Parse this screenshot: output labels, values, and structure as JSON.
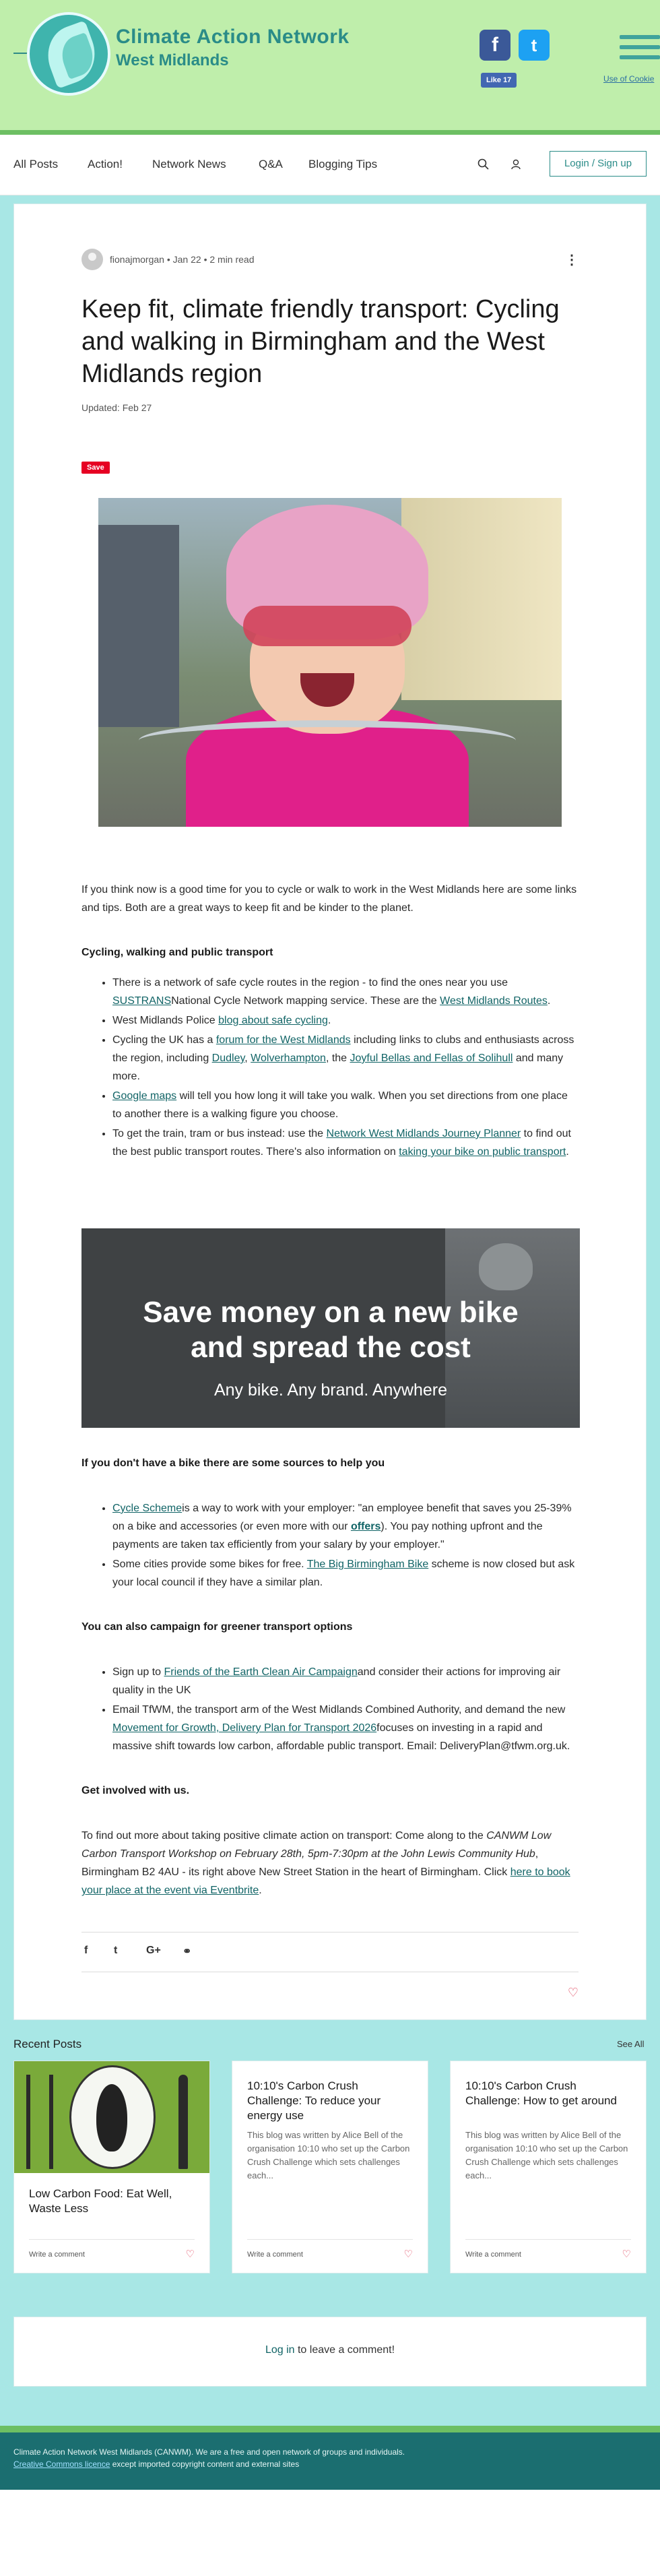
{
  "header": {
    "title": "Climate Action Network",
    "subtitle": "West Midlands",
    "facebook_glyph": "f",
    "twitter_glyph": "t",
    "like_label": "Like 17",
    "cookie_link": "Use of Cookie",
    "logo_icon": "leaf-logo-icon",
    "colors": {
      "header_bg": "#bfeeab",
      "brand": "#2a8c88",
      "page_bg": "#a8e7e5"
    }
  },
  "nav": {
    "items": [
      "All Posts",
      "Action!",
      "Network News",
      "Q&A",
      "Blogging Tips"
    ],
    "login_label": "Login / Sign up",
    "search_icon": "search-icon",
    "user_icon": "user-icon"
  },
  "post": {
    "author": "fionajmorgan",
    "date": "Jan 22",
    "read_time": "2 min read",
    "meta_sep": "•",
    "more": "⋮",
    "title": "Keep fit, climate friendly transport: Cycling and walking in Birmingham and the West Midlands region",
    "updated": "Updated: Feb 27",
    "save_label": "Save",
    "intro": "If you think now is a good time for you to cycle or walk to work in the West Midlands here are some links and tips.  Both are a great ways to keep fit and be kinder to the planet.",
    "section1": {
      "heading": "Cycling, walking and public transport",
      "b1_a": "There is a network of safe cycle routes in the region - to find the ones near you use ",
      "b1_link1": "SUSTRANS",
      "b1_b": "National Cycle Network mapping service.  These are the ",
      "b1_link2": "West Midlands Routes",
      "b1_c": ".",
      "b2_a": "West Midlands Police ",
      "b2_link": "blog about safe cycling",
      "b2_b": ".",
      "b3_a": "Cycling the UK has a ",
      "b3_link1": "forum for the West Midlands",
      "b3_b": " including links to clubs and enthusiasts across the region, including ",
      "b3_link2": "Dudley",
      "b3_c": ", ",
      "b3_link3": "Wolverhampton",
      "b3_d": ", the ",
      "b3_link4": "Joyful Bellas and Fellas of Solihull",
      "b3_e": " and many more.",
      "b4_link": "Google maps",
      "b4_a": " will tell you how long it will take you walk.  When you set directions from one place to another there is a walking figure you choose.",
      "b5_a": "To get the train, tram or bus instead:  use the ",
      "b5_link1": "Network West Midlands Journey Planner",
      "b5_b": " to find out the best public transport routes.   There's also information on ",
      "b5_link2": "taking your bike on public transport",
      "b5_c": "."
    },
    "banner": {
      "line1": "Save money on a new bike",
      "line2": "and spread the cost",
      "line3": "Any bike. Any brand. Anywhere"
    },
    "section2": {
      "heading": "If you don't have a bike there are some sources to help you",
      "b1_link": "Cycle Scheme",
      "b1_a": "is a way to work with your employer: \"an employee benefit that saves you 25-39% on a bike and accessories (or even more with our ",
      "b1_link2": "offers",
      "b1_b": "). You pay nothing upfront and the payments are taken tax efficiently from your salary by your employer.\"",
      "b2_a": "Some cities provide some bikes for free.  ",
      "b2_link": "The Big Birmingham Bike",
      "b2_b": " scheme is now closed but ask your local council if they have a similar plan."
    },
    "section3": {
      "heading": "You can also campaign for greener transport options",
      "b1_a": "Sign up to ",
      "b1_link": "Friends of the Earth Clean Air Campaign",
      "b1_b": "and consider their actions for improving air quality in the UK",
      "b2_a": "Email TfWM, the transport arm of the West Midlands Combined Authority, and demand the new ",
      "b2_link": "Movement for Growth, Delivery Plan for Transport 2026",
      "b2_b": "focuses on investing in a rapid and massive shift towards low carbon, affordable public transport. Email: DeliveryPlan@tfwm.org.uk."
    },
    "section4": {
      "heading": "Get involved with us.",
      "p_a": "To find out more about taking positive climate action on transport: Come along to the ",
      "p_em": "CANWM Low Carbon Transport Workshop on February 28th, 5pm-7:30pm at the John Lewis Community Hub",
      "p_b": ", Birmingham B2 4AU - its right above New Street Station in the heart of Birmingham.  Click ",
      "p_link": "here to book your place at the event via Eventbrite",
      "p_c": "."
    },
    "share": {
      "facebook": "f",
      "twitter": "t",
      "google": "G+",
      "link": "⚭"
    },
    "like_heart": "♡"
  },
  "recent": {
    "heading": "Recent Posts",
    "see_all": "See All",
    "cards": [
      {
        "title": "Low Carbon Food: Eat Well, Waste Less",
        "excerpt": "",
        "comment": "Write a comment",
        "heart": "♡"
      },
      {
        "title": "10:10's Carbon Crush Challenge: To reduce your energy use",
        "excerpt": "This blog was written by Alice Bell of the organisation 10:10 who set up the Carbon Crush Challenge which sets challenges each...",
        "comment": "Write a comment",
        "heart": "♡"
      },
      {
        "title": "10:10's Carbon Crush Challenge: How to get around",
        "excerpt": "This blog was written by Alice Bell of the organisation 10:10 who set up the Carbon Crush Challenge which sets challenges each...",
        "comment": "Write a comment",
        "heart": "♡"
      }
    ]
  },
  "comments": {
    "login_link": "Log in",
    "text": " to leave a comment!"
  },
  "footer": {
    "line1": "Climate Action Network West Midlands (CANWM).  We are a free and open network of groups and individuals.",
    "license_link": "Creative Commons licence",
    "line2_rest": " except imported copyright content and external sites"
  }
}
